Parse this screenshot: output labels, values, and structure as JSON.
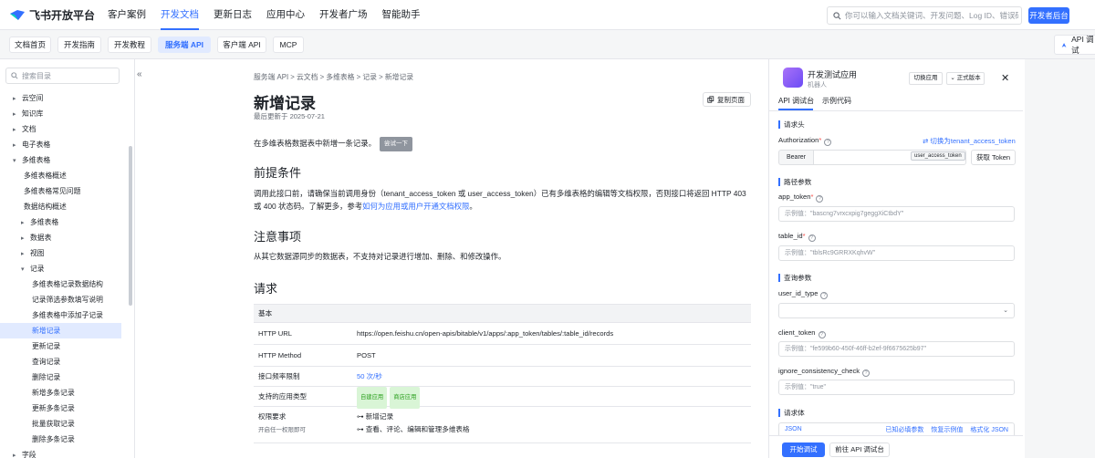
{
  "header": {
    "brand": "飞书开放平台",
    "nav": [
      "客户案例",
      "开发文档",
      "更新日志",
      "应用中心",
      "开发者广场",
      "智能助手"
    ],
    "nav_active_index": 1,
    "search_placeholder": "你可以输入文档关键词、开发问题、Log ID、错误码",
    "console_button": "开发者后台"
  },
  "subnav": {
    "tabs": [
      "文档首页",
      "开发指南",
      "开发教程",
      "服务端 API",
      "客户端 API",
      "MCP"
    ],
    "active_index": 3,
    "api_debug": "API 调试"
  },
  "sidebar": {
    "search_placeholder": "搜索目录",
    "items": [
      {
        "label": "云空间",
        "caret": "▸"
      },
      {
        "label": "知识库",
        "caret": "▸"
      },
      {
        "label": "文档",
        "caret": "▸"
      },
      {
        "label": "电子表格",
        "caret": "▸"
      },
      {
        "label": "多维表格",
        "caret": "▾"
      },
      {
        "label": "多维表格概述",
        "caret": ""
      },
      {
        "label": "多维表格常见问题",
        "caret": ""
      },
      {
        "label": "数据结构概述",
        "caret": ""
      },
      {
        "label": "多维表格",
        "caret": "▸"
      },
      {
        "label": "数据表",
        "caret": "▸"
      },
      {
        "label": "视图",
        "caret": "▸"
      },
      {
        "label": "记录",
        "caret": "▾"
      },
      {
        "label": "多维表格记录数据结构",
        "caret": ""
      },
      {
        "label": "记录筛选参数填写说明",
        "caret": ""
      },
      {
        "label": "多维表格中添加子记录",
        "caret": ""
      },
      {
        "label": "新增记录",
        "caret": ""
      },
      {
        "label": "更新记录",
        "caret": ""
      },
      {
        "label": "查询记录",
        "caret": ""
      },
      {
        "label": "删除记录",
        "caret": ""
      },
      {
        "label": "新增多条记录",
        "caret": ""
      },
      {
        "label": "更新多条记录",
        "caret": ""
      },
      {
        "label": "批量获取记录",
        "caret": ""
      },
      {
        "label": "删除多条记录",
        "caret": ""
      },
      {
        "label": "字段",
        "caret": "▸"
      }
    ]
  },
  "doc": {
    "breadcrumb": [
      "服务端 API",
      "云文档",
      "多维表格",
      "记录",
      "新增记录"
    ],
    "title": "新增记录",
    "updated": "最后更新于 2025-07-21",
    "copy_page": "复制页面",
    "intro": "在多维表格数据表中新增一条记录。",
    "try_it": "尝试一下",
    "h_prereq": "前提条件",
    "prereq_text": "调用此接口前，请确保当前调用身份（tenant_access_token 或 user_access_token）已有多维表格的编辑等文档权限，否则接口将返回 HTTP 403 或 400 状态码。了解更多，参考",
    "prereq_link": "如何为应用或用户开通文档权限",
    "prereq_end": "。",
    "h_notes": "注意事项",
    "notes_text": "从其它数据源同步的数据表，不支持对记录进行增加、删除、和修改操作。",
    "h_request": "请求",
    "table": {
      "head": "基本",
      "rows": [
        {
          "k": "HTTP URL",
          "v": "https://open.feishu.cn/open-apis/bitable/v1/apps/:app_token/tables/:table_id/records"
        },
        {
          "k": "HTTP Method",
          "v": "POST"
        },
        {
          "k": "接口频率限制",
          "v": "50 次/秒"
        },
        {
          "k": "支持的应用类型",
          "badges": [
            "自建应用",
            "商店应用"
          ]
        },
        {
          "k": "权限要求",
          "note": "开启任一权限即可",
          "perms": [
            "新增记录",
            "查看、评论、编辑和管理多维表格"
          ]
        }
      ]
    }
  },
  "panel": {
    "app_name": "开发测试应用",
    "app_role": "机器人",
    "switch_app": "切换应用",
    "version": "正式版本",
    "tabs": [
      "API 调试台",
      "示例代码"
    ],
    "sec_headers": "请求头",
    "authorization": "Authorization",
    "switch_token": "切换为tenant_access_token",
    "bearer": "Bearer",
    "token_tag": "user_access_token",
    "get_token": "获取 Token",
    "sec_path": "路径参数",
    "app_token": "app_token",
    "app_token_ph": "示例值：\"bascng7vrxcxpig7geggXiCtbdY\"",
    "table_id": "table_id",
    "table_id_ph": "示例值：\"tblsRc9GRRXKqhvW\"",
    "sec_query": "查询参数",
    "user_id_type": "user_id_type",
    "client_token": "client_token",
    "client_token_ph": "示例值：\"fe599b60-450f-46ff-b2ef-9f6675625b97\"",
    "ignore": "ignore_consistency_check",
    "ignore_ph": "示例值：\"true\"",
    "sec_body": "请求体",
    "body_json": "JSON",
    "body_actions": [
      "已知必填参数",
      "恢复示例值",
      "格式化 JSON"
    ],
    "start_debug": "开始调试",
    "goto_debug": "前往 API 调试台"
  },
  "colors": {
    "accent": "#3370ff",
    "success": "#2ea121",
    "required": "#f54a45"
  }
}
